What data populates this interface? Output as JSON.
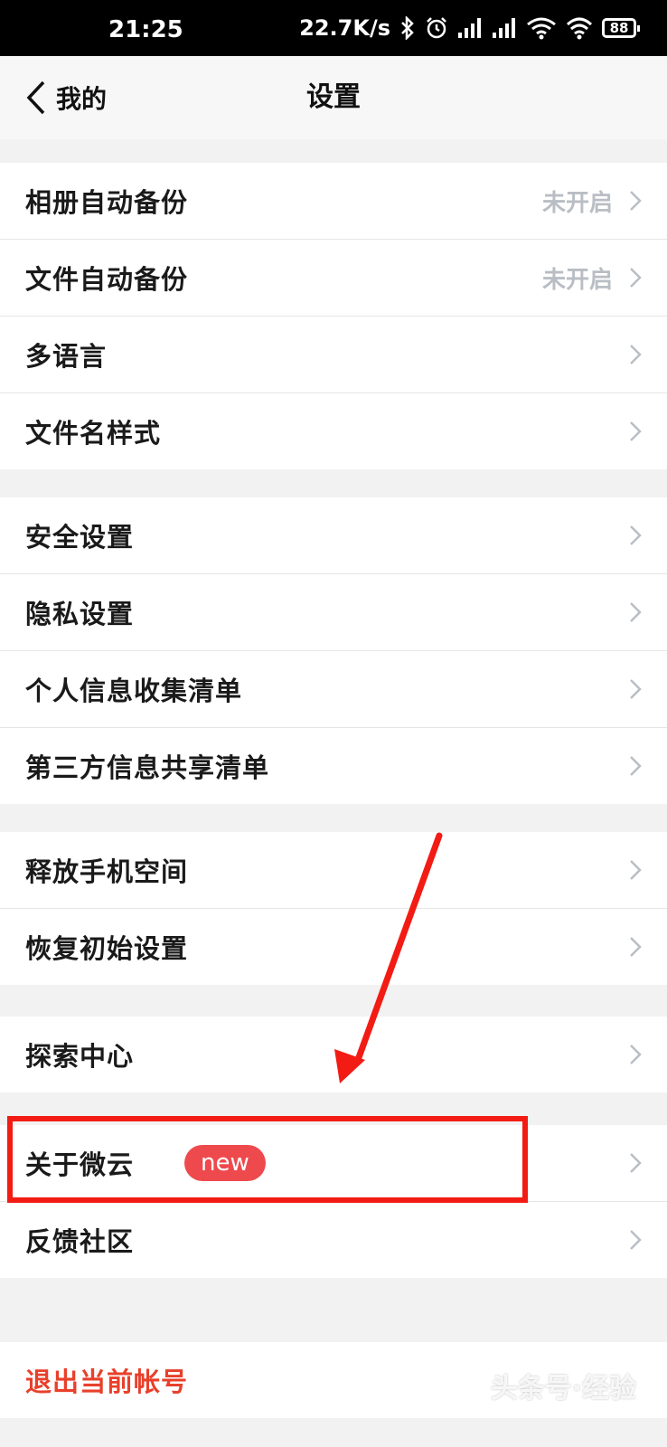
{
  "status_bar": {
    "time": "21:25",
    "net_speed": "22.7K/s",
    "battery": "88",
    "icons": [
      "bluetooth-icon",
      "alarm-icon",
      "signal-icon",
      "signal-icon",
      "wifi-hd-icon",
      "wifi-icon",
      "battery-icon"
    ]
  },
  "nav": {
    "back_label": "我的",
    "title": "设置"
  },
  "groups": {
    "g1": [
      {
        "label": "相册自动备份",
        "value": "未开启"
      },
      {
        "label": "文件自动备份",
        "value": "未开启"
      },
      {
        "label": "多语言"
      },
      {
        "label": "文件名样式"
      }
    ],
    "g2": [
      {
        "label": "安全设置"
      },
      {
        "label": "隐私设置"
      },
      {
        "label": "个人信息收集清单"
      },
      {
        "label": "第三方信息共享清单"
      }
    ],
    "g3": [
      {
        "label": "释放手机空间"
      },
      {
        "label": "恢复初始设置"
      }
    ],
    "g4": [
      {
        "label": "探索中心"
      }
    ],
    "g5": [
      {
        "label": "关于微云",
        "badge": "new"
      },
      {
        "label": "反馈社区"
      }
    ],
    "g6": [
      {
        "label": "退出当前帐号"
      }
    ]
  },
  "colors": {
    "accent_red": "#e8402b",
    "badge_red": "#ee4a4d",
    "annotation_red": "#f21c14",
    "value_gray": "#b9bec4"
  },
  "watermark": "头条号·经验"
}
